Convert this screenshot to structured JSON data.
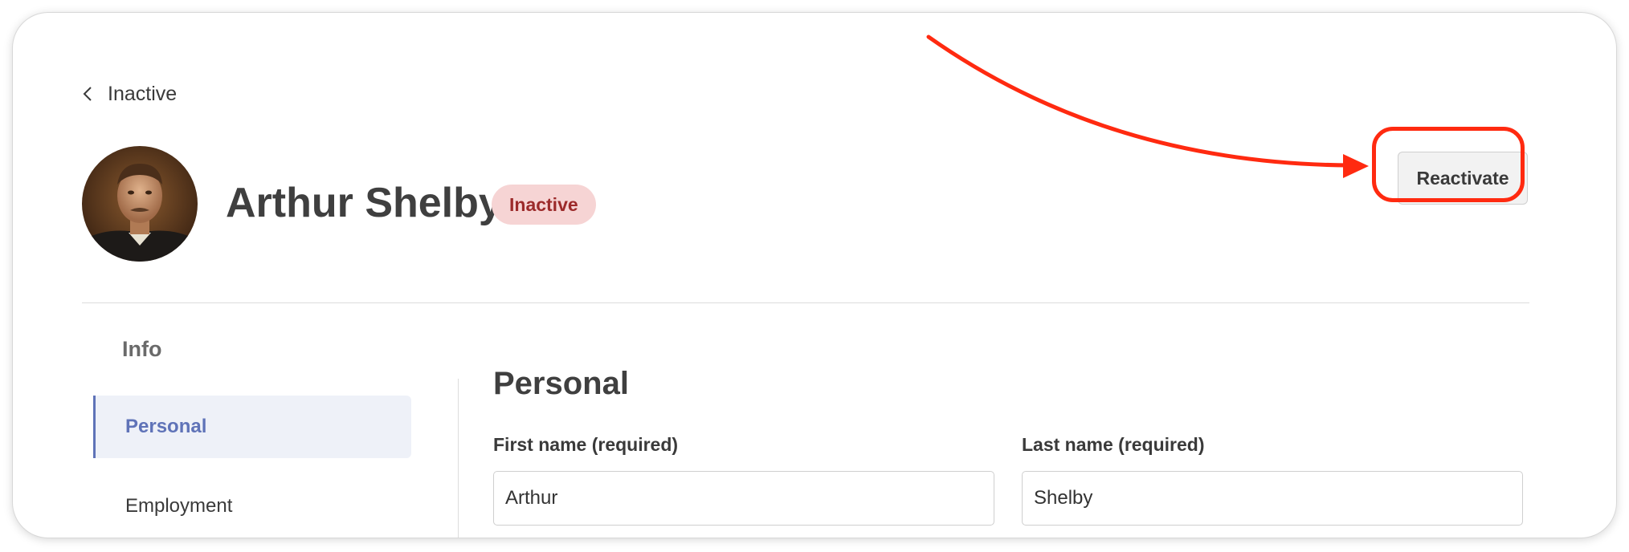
{
  "breadcrumb": {
    "back_label": "Inactive"
  },
  "profile": {
    "name": "Arthur Shelby",
    "status": "Inactive",
    "status_color": "#9c2a2a",
    "status_bg": "#f6d4d4"
  },
  "actions": {
    "reactivate_label": "Reactivate"
  },
  "sidebar": {
    "heading": "Info",
    "items": [
      {
        "label": "Personal",
        "active": true
      },
      {
        "label": "Employment",
        "active": false
      }
    ]
  },
  "section": {
    "title": "Personal",
    "fields": [
      {
        "label": "First name (required)",
        "value": "Arthur"
      },
      {
        "label": "Last name (required)",
        "value": "Shelby"
      }
    ]
  },
  "annotation": {
    "color": "#ff2a10"
  },
  "colors": {
    "accent": "#5f73b8",
    "accent_bg": "#eef1f8"
  }
}
